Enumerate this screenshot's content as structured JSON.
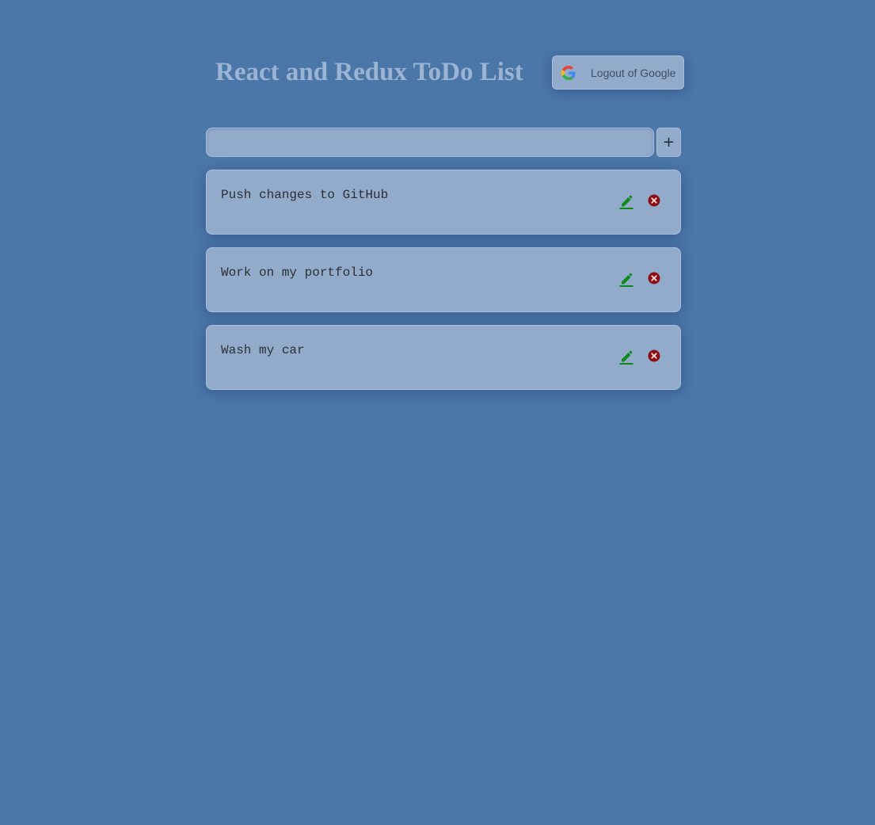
{
  "header": {
    "title": "React and Redux ToDo List"
  },
  "auth": {
    "logout_label": "Logout of Google",
    "icon": "google-icon"
  },
  "new_todo": {
    "value": "",
    "placeholder": "",
    "add_label": "+"
  },
  "todos": [
    {
      "text": "Push changes to GitHub",
      "edit_icon": "pencil-icon",
      "delete_icon": "circle-x-icon"
    },
    {
      "text": "Work on my portfolio",
      "edit_icon": "pencil-icon",
      "delete_icon": "circle-x-icon"
    },
    {
      "text": "Wash my car",
      "edit_icon": "pencil-icon",
      "delete_icon": "circle-x-icon"
    }
  ],
  "colors": {
    "background": "#4b76a8",
    "card": "#93abcb",
    "title": "#9bb4d3",
    "edit": "#0d8a1a",
    "delete": "#8b0e14"
  }
}
